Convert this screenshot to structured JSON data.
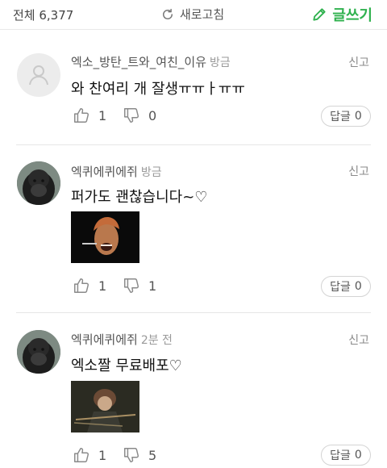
{
  "header": {
    "total_label": "전체 6,377",
    "refresh_label": "새로고침",
    "write_label": "글쓰기"
  },
  "comments": [
    {
      "nickname": "엑소_방탄_트와_여친_이유",
      "time": "방금",
      "report": "신고",
      "text": "와 찬여리 개 잘생ㅠㅠㅏㅠㅠ",
      "likes": "1",
      "dislikes": "0",
      "reply": "답글",
      "reply_count": "0"
    },
    {
      "nickname": "엑퀴에퀴에쥐",
      "time": "방금",
      "report": "신고",
      "text": "퍼가도 괜찮습니다~♡",
      "likes": "1",
      "dislikes": "1",
      "reply": "답글",
      "reply_count": "0"
    },
    {
      "nickname": "엑퀴에퀴에쥐",
      "time": "2분 전",
      "report": "신고",
      "text": "엑소짤 무료배포♡",
      "likes": "1",
      "dislikes": "5",
      "reply": "답글",
      "reply_count": "0"
    }
  ],
  "icons": {
    "refresh": "refresh-icon",
    "write": "pencil-icon",
    "like": "thumbs-up-icon",
    "dislike": "thumbs-down-icon",
    "default_avatar": "person-icon"
  },
  "colors": {
    "accent_green": "#2fb14e"
  }
}
